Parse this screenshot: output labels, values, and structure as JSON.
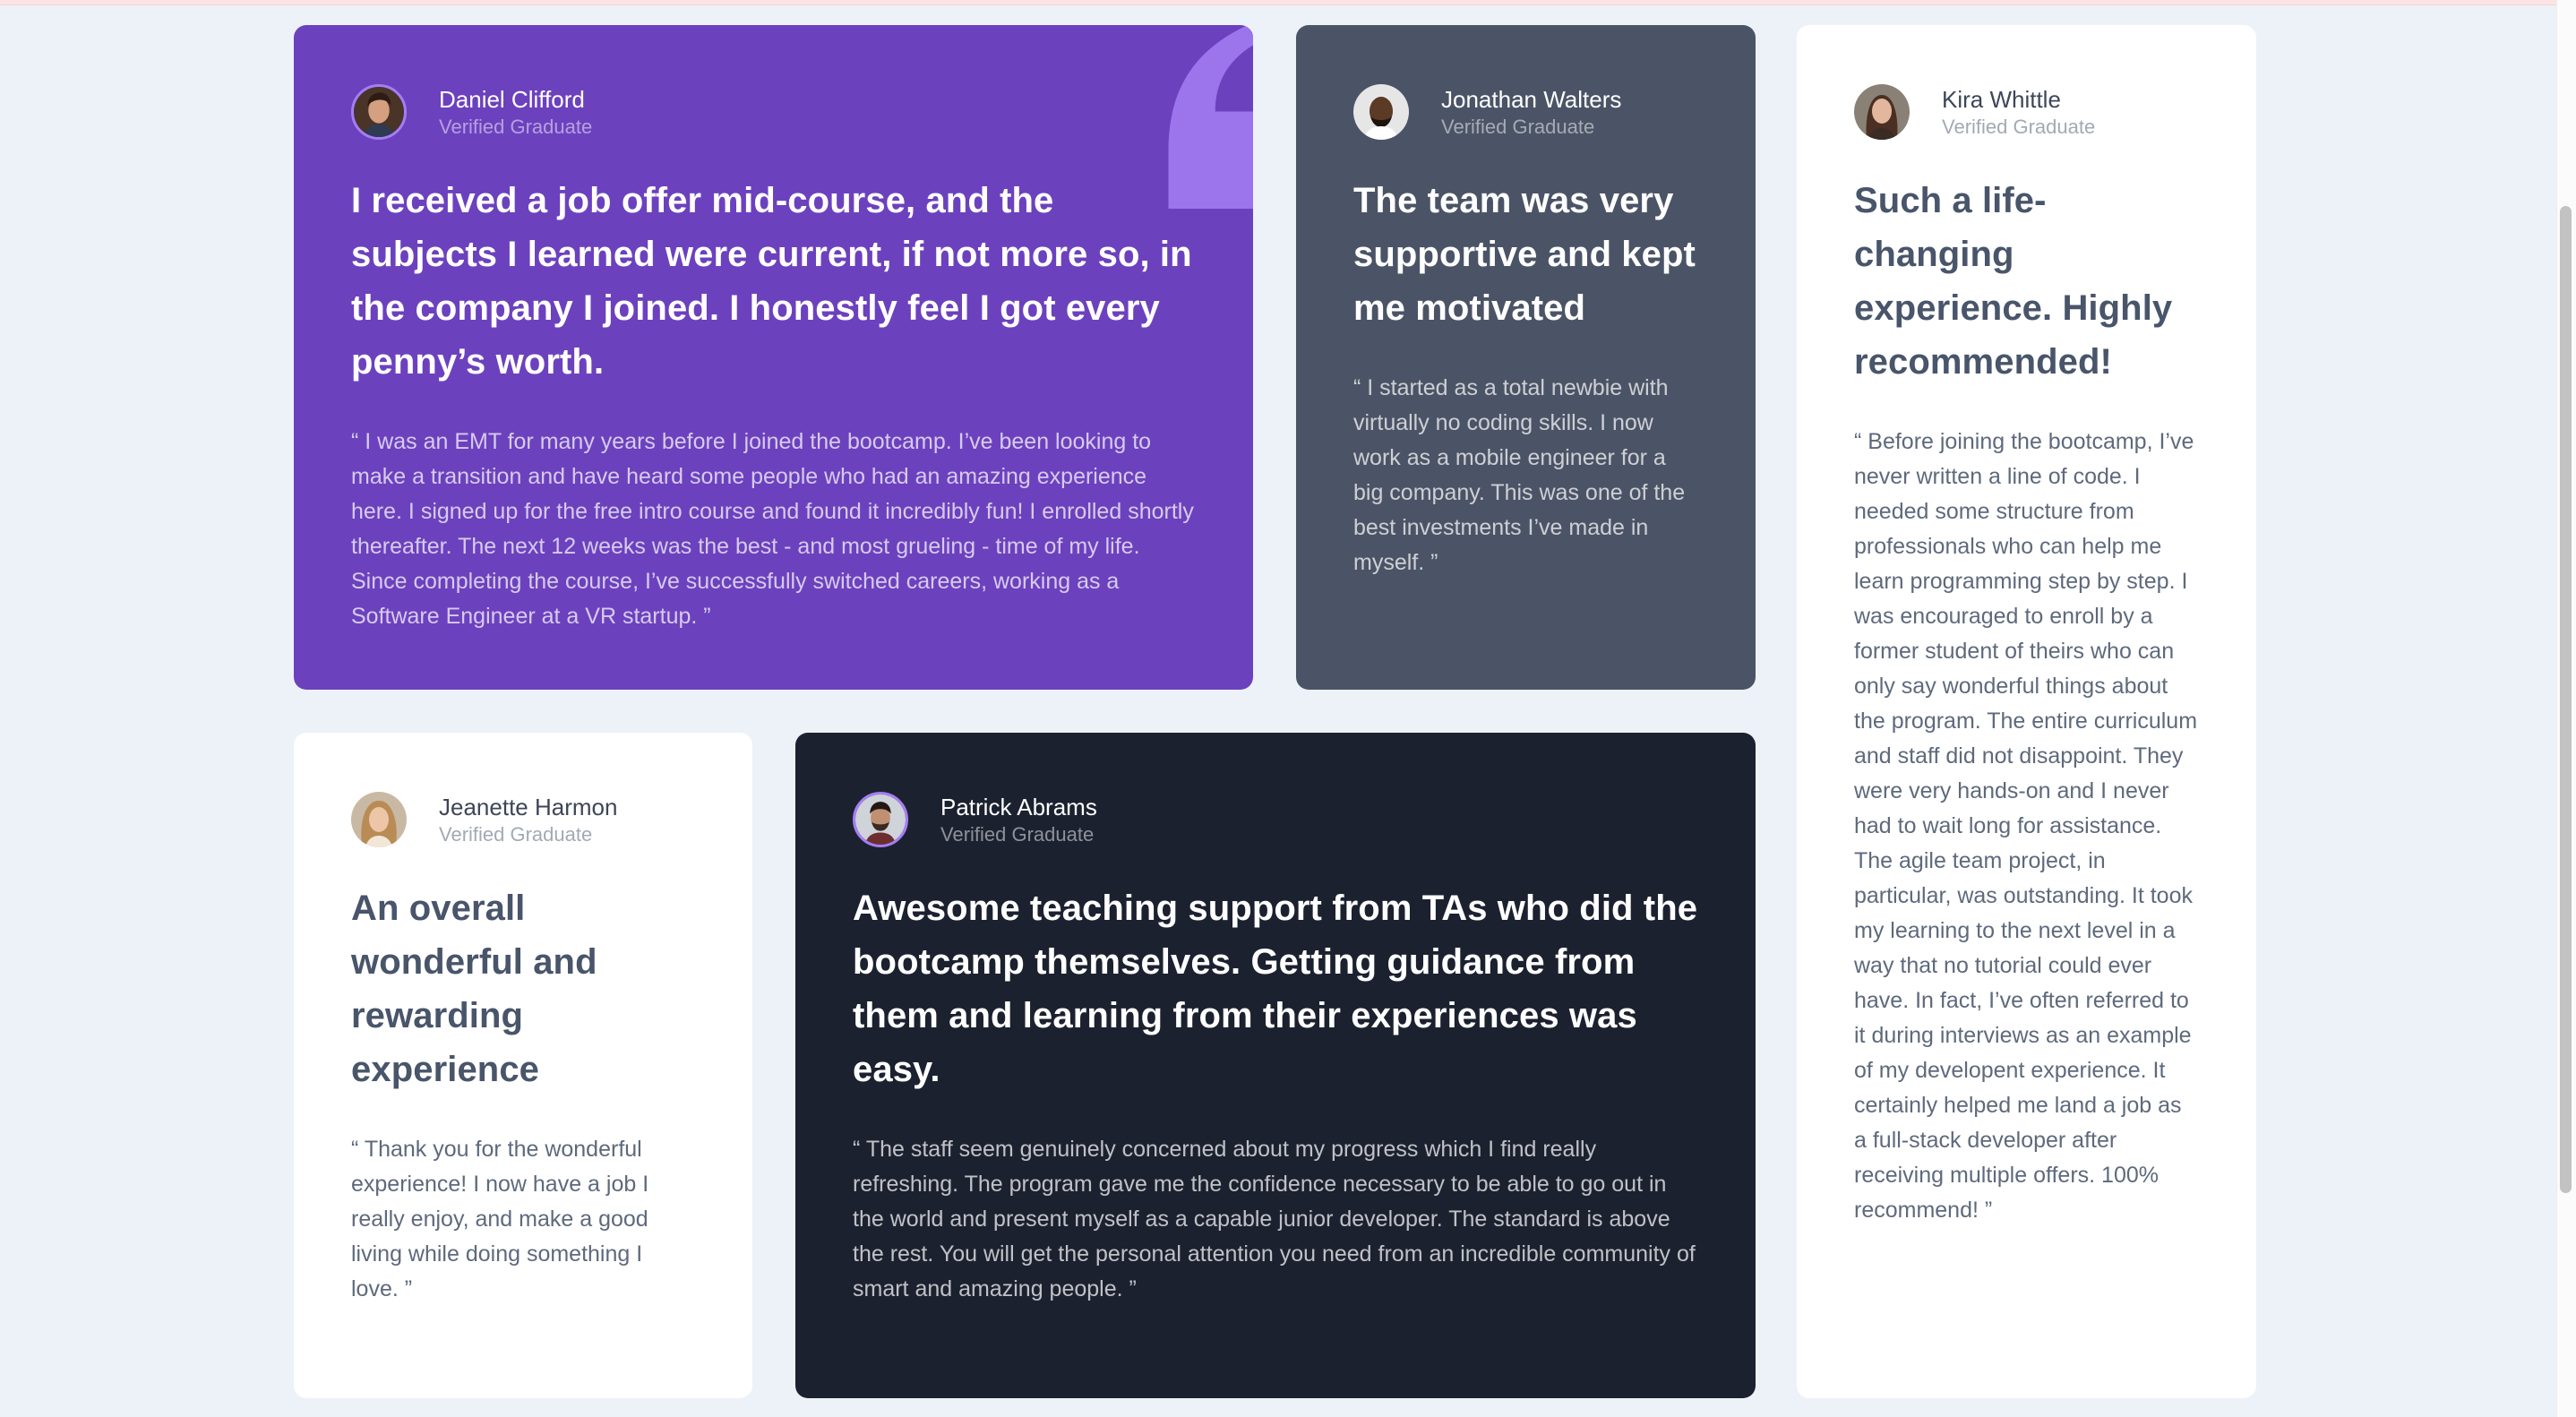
{
  "testimonials": [
    {
      "id": "daniel",
      "name": "Daniel Clifford",
      "status": "Verified Graduate",
      "headline": "I received a job offer mid-course, and the subjects I learned were current, if not more so, in the company I joined. I honestly feel I got every penny’s worth.",
      "quote": "“ I was an EMT for many years before I joined the bootcamp. I’ve been looking to make a transition and have heard some people who had an amazing experience here. I signed up for the free intro course and found it incredibly fun! I enrolled shortly thereafter. The next 12 weeks was the best - and most grueling - time of my life. Since completing the course, I’ve successfully switched careers, working as a Software Engineer at a VR startup. ”"
    },
    {
      "id": "jonathan",
      "name": "Jonathan Walters",
      "status": "Verified Graduate",
      "headline": "The team was very supportive and kept me motivated",
      "quote": "“ I started as a total newbie with virtually no coding skills. I now work as a mobile engineer for a big company. This was one of the best investments I’ve made in myself. ”"
    },
    {
      "id": "kira",
      "name": "Kira Whittle",
      "status": "Verified Graduate",
      "headline": "Such a life-changing experience. Highly recommended!",
      "quote": "“ Before joining the bootcamp, I’ve never written a line of code. I needed some structure from professionals who can help me learn programming step by step. I was encouraged to enroll by a former student of theirs who can only say wonderful things about the program. The entire curriculum and staff did not disappoint. They were very hands-on and I never had to wait long for assistance. The agile team project, in particular, was outstanding. It took my learning to the next level in a way that no tutorial could ever have. In fact, I’ve often referred to it during interviews as an example of my developent experience. It certainly helped me land a job as a full-stack developer after receiving multiple offers. 100% recommend! ”"
    },
    {
      "id": "jeanette",
      "name": "Jeanette Harmon",
      "status": "Verified Graduate",
      "headline": "An overall wonderful and rewarding experience",
      "quote": "“ Thank you for the wonderful experience! I now have a job I really enjoy, and make a good living while doing something I love. ”"
    },
    {
      "id": "patrick",
      "name": "Patrick Abrams",
      "status": "Verified Graduate",
      "headline": "Awesome teaching support from TAs who did the bootcamp themselves. Getting guidance from them and learning from their experiences was easy.",
      "quote": "“ The staff seem genuinely concerned about my progress which I find really refreshing. The program gave me the confidence necessary to be able to go out in the world and present myself as a capable junior developer. The standard is above the rest. You will get the personal attention you need from an incredible community of smart and amazing people. ”"
    }
  ],
  "colors": {
    "page_background": "#edf2f8",
    "moderate_violet": "#6c41be",
    "grayish_blue": "#4b5466",
    "very_dark_blackish_blue": "#1c2130",
    "white": "#ffffff",
    "quote_mark": "#a57ef5"
  },
  "icons": {
    "decorative_quote": "quote-mark-icon",
    "avatars": "avatar-photo"
  }
}
